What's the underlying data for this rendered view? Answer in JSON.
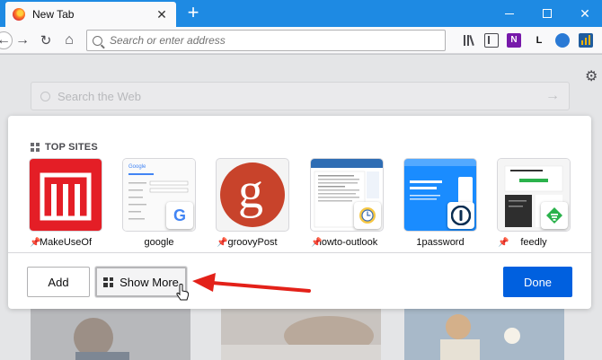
{
  "browser": {
    "tab_title": "New Tab",
    "close_symbol": "✕",
    "new_tab_symbol": "+"
  },
  "nav": {
    "back_symbol": "←",
    "forward_symbol": "→",
    "reload_symbol": "↻",
    "home_symbol": "⌂",
    "url_placeholder": "Search or enter address",
    "onenote_letter": "N",
    "l_extension_letter": "L"
  },
  "page": {
    "search_placeholder": "Search the Web",
    "search_arrow": "→",
    "gear_symbol": "⚙"
  },
  "top_sites": {
    "heading": "TOP SITES",
    "sites": [
      {
        "label": "MakeUseOf",
        "pinned": true
      },
      {
        "label": "google",
        "pinned": false
      },
      {
        "label": "groovyPost",
        "pinned": true
      },
      {
        "label": "howto-outlook",
        "pinned": true
      },
      {
        "label": "1password",
        "pinned": false
      },
      {
        "label": "feedly",
        "pinned": true
      }
    ],
    "groovypost_letter": "g",
    "google_letter": "G",
    "google_thumb_logo": "Google"
  },
  "buttons": {
    "add": "Add",
    "show_more": "Show More",
    "done": "Done"
  },
  "colors": {
    "titlebar": "#1e8ae3",
    "done_button": "#0060df",
    "makeuseof": "#e41e26",
    "groovypost": "#c8432b",
    "annotation_arrow": "#e32119"
  }
}
